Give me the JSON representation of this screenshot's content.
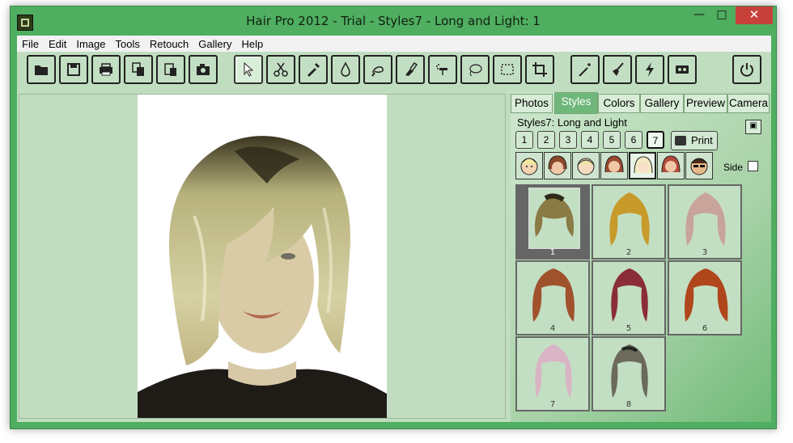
{
  "window": {
    "title": "Hair Pro 2012 - Trial - Styles7 - Long and Light: 1"
  },
  "menu": [
    "File",
    "Edit",
    "Image",
    "Tools",
    "Retouch",
    "Gallery",
    "Help"
  ],
  "toolbar": {
    "icons": [
      "open-icon",
      "save-icon",
      "print-icon",
      "copy-icon",
      "paste-icon",
      "camera-icon",
      "pointer-icon",
      "scissors-icon",
      "eyedropper-icon",
      "drop-icon",
      "lasso-brush-icon",
      "smudge-icon",
      "airbrush-icon",
      "lasso-icon",
      "select-rect-icon",
      "crop-icon",
      "wand-icon",
      "broom-icon",
      "lightning-icon",
      "tape-icon",
      "power-icon"
    ]
  },
  "panel": {
    "tabs": [
      "Photos",
      "Styles",
      "Colors",
      "Gallery",
      "Preview",
      "Camera"
    ],
    "selected_tab": "Styles",
    "style_label": "Styles7: Long and Light",
    "pages": [
      "1",
      "2",
      "3",
      "4",
      "5",
      "6",
      "7"
    ],
    "selected_page": "7",
    "print_label": "Print",
    "side_label": "Side",
    "styles": [
      {
        "num": "1",
        "color": "#8a7a44"
      },
      {
        "num": "2",
        "color": "#c79a2a"
      },
      {
        "num": "3",
        "color": "#c9a49a"
      },
      {
        "num": "4",
        "color": "#a0522d"
      },
      {
        "num": "5",
        "color": "#8b2c3a"
      },
      {
        "num": "6",
        "color": "#b0461c"
      },
      {
        "num": "7",
        "color": "#d8b4c4"
      },
      {
        "num": "8",
        "color": "#6c6a5a"
      }
    ],
    "selected_style": "1"
  },
  "colors": {
    "accent": "#4fae60",
    "panel": "#c0ddc0",
    "close": "#c7403a"
  }
}
